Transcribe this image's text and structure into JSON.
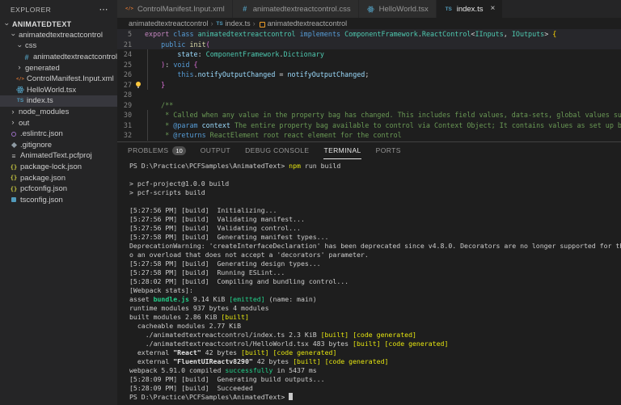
{
  "ui": {
    "close_glyph": "×",
    "chevron_glyph": "›",
    "more_glyph": "⋯",
    "breadcrumb_sep": "›",
    "decoration_glyph": "○"
  },
  "icons": {
    "xml": "</>",
    "css": "#",
    "ts": "TS",
    "json": "{}",
    "proj": "≡",
    "react": "",
    "eslint": "",
    "git": "",
    "tsconfig": "",
    "class": ""
  },
  "colors": {
    "editor_bg": "#1e1e1e",
    "sidebar_bg": "#252526",
    "tab_inactive_bg": "#2d2d2d",
    "selection_bg": "#37373d",
    "accent_ts_blue": "#519aba",
    "xml_orange": "#e37933",
    "json_yellow": "#cbcb41",
    "terminal_green": "#23d18b",
    "terminal_yellow": "#e5e510"
  },
  "explorer": {
    "title": "EXPLORER",
    "items": [
      {
        "label": "ANIMATEDTEXT",
        "depth": 0,
        "chevron": "down",
        "bold": true
      },
      {
        "label": "animatedtextreactcontrol",
        "depth": 1,
        "chevron": "down"
      },
      {
        "label": "css",
        "depth": 2,
        "chevron": "down"
      },
      {
        "label": "animatedtextreactcontrol.css",
        "depth": 3,
        "icon": "css"
      },
      {
        "label": "generated",
        "depth": 2,
        "chevron": "right"
      },
      {
        "label": "ControlManifest.Input.xml",
        "depth": 2,
        "icon": "xml"
      },
      {
        "label": "HelloWorld.tsx",
        "depth": 2,
        "icon": "react"
      },
      {
        "label": "index.ts",
        "depth": 2,
        "icon": "ts",
        "selected": true
      },
      {
        "label": "node_modules",
        "depth": 1,
        "chevron": "right"
      },
      {
        "label": "out",
        "depth": 1,
        "chevron": "right"
      },
      {
        "label": ".eslintrc.json",
        "depth": 1,
        "icon": "eslint"
      },
      {
        "label": ".gitignore",
        "depth": 1,
        "icon": "git"
      },
      {
        "label": "AnimatedText.pcfproj",
        "depth": 1,
        "icon": "proj"
      },
      {
        "label": "package-lock.json",
        "depth": 1,
        "icon": "json"
      },
      {
        "label": "package.json",
        "depth": 1,
        "icon": "json"
      },
      {
        "label": "pcfconfig.json",
        "depth": 1,
        "icon": "json"
      },
      {
        "label": "tsconfig.json",
        "depth": 1,
        "icon": "tsconfig"
      }
    ]
  },
  "editor_tabs": [
    {
      "label": "ControlManifest.Input.xml",
      "icon": "xml",
      "active": false
    },
    {
      "label": "animatedtextreactcontrol.css",
      "icon": "css",
      "active": false
    },
    {
      "label": "HelloWorld.tsx",
      "icon": "react",
      "active": false
    },
    {
      "label": "index.ts",
      "icon": "ts",
      "active": true
    }
  ],
  "breadcrumb": {
    "items": [
      {
        "label": "animatedtextreactcontrol"
      },
      {
        "label": "index.ts",
        "icon": "ts"
      },
      {
        "label": "animatedtextreactcontrol",
        "icon": "class"
      }
    ]
  },
  "editor": {
    "lines": [
      {
        "num": "5",
        "highlight": true,
        "tokens": [
          [
            "export ",
            "ctl"
          ],
          [
            "class ",
            "kw"
          ],
          [
            "animatedtextreactcontrol",
            "type"
          ],
          [
            " implements ",
            "kw"
          ],
          [
            "ComponentFramework",
            "type"
          ],
          [
            ".",
            "p"
          ],
          [
            "ReactControl",
            "type"
          ],
          [
            "<",
            "p"
          ],
          [
            "IInputs",
            "type"
          ],
          [
            ", ",
            "p"
          ],
          [
            "IOutputs",
            "type"
          ],
          [
            "> ",
            "p"
          ],
          [
            "{",
            "b1"
          ]
        ]
      },
      {
        "num": "21",
        "highlight": true,
        "tokens": [
          [
            "    ",
            "p"
          ],
          [
            "public ",
            "kw"
          ],
          [
            "init",
            "fn"
          ],
          [
            "(",
            "b2"
          ]
        ]
      },
      {
        "num": "24",
        "guide": true,
        "tokens": [
          [
            "        ",
            "p"
          ],
          [
            "state",
            "var"
          ],
          [
            ": ",
            "p"
          ],
          [
            "ComponentFramework",
            "type"
          ],
          [
            ".",
            "p"
          ],
          [
            "Dictionary",
            "type"
          ]
        ]
      },
      {
        "num": "25",
        "guide": true,
        "tokens": [
          [
            "    ",
            "p"
          ],
          [
            ")",
            "b2"
          ],
          [
            ": ",
            "p"
          ],
          [
            "void",
            "kw"
          ],
          [
            " ",
            "p"
          ],
          [
            "{",
            "b2"
          ]
        ]
      },
      {
        "num": "26",
        "guide": true,
        "tokens": [
          [
            "        ",
            "p"
          ],
          [
            "this",
            "kw"
          ],
          [
            ".",
            "p"
          ],
          [
            "notifyOutputChanged",
            "var"
          ],
          [
            " = ",
            "p"
          ],
          [
            "notifyOutputChanged",
            "var"
          ],
          [
            ";",
            "p"
          ]
        ]
      },
      {
        "num": "27",
        "guide": true,
        "lightbulb": true,
        "tokens": [
          [
            "    ",
            "p"
          ],
          [
            "}",
            "b2"
          ]
        ]
      },
      {
        "num": "28",
        "tokens": []
      },
      {
        "num": "29",
        "tokens": [
          [
            "    /**",
            "cmt"
          ]
        ]
      },
      {
        "num": "30",
        "guide": true,
        "tokens": [
          [
            "     * Called when any value in the property bag has changed. This includes field values, data-sets, global values su",
            "cmt"
          ]
        ]
      },
      {
        "num": "31",
        "guide": true,
        "tokens": [
          [
            "     * ",
            "cmt"
          ],
          [
            "@param",
            "kw"
          ],
          [
            " ",
            "cmt"
          ],
          [
            "context",
            "var"
          ],
          [
            " The entire property bag available to control via Context Object; It contains values as set up b",
            "cmt"
          ]
        ]
      },
      {
        "num": "32",
        "guide": true,
        "tokens": [
          [
            "     * ",
            "cmt"
          ],
          [
            "@returns",
            "kw"
          ],
          [
            " ReactElement root react element for the control",
            "cmt"
          ]
        ]
      }
    ]
  },
  "panel": {
    "tabs": [
      {
        "label": "PROBLEMS",
        "badge": "10",
        "active": false
      },
      {
        "label": "OUTPUT",
        "active": false
      },
      {
        "label": "DEBUG CONSOLE",
        "active": false
      },
      {
        "label": "TERMINAL",
        "active": true
      },
      {
        "label": "PORTS",
        "active": false
      }
    ],
    "terminal": {
      "lines": [
        {
          "tokens": [
            [
              "PS D:\\Practice\\PCFSamples\\AnimatedText> ",
              "d"
            ],
            [
              "npm",
              "y"
            ],
            [
              " run build",
              "d"
            ]
          ]
        },
        {
          "tokens": []
        },
        {
          "tokens": [
            [
              "> pcf-project@1.0.0 build",
              "d"
            ]
          ]
        },
        {
          "tokens": [
            [
              "> pcf-scripts build",
              "d"
            ]
          ]
        },
        {
          "tokens": []
        },
        {
          "tokens": [
            [
              "[5:27:56 PM] [build]  Initializing...",
              "d"
            ]
          ]
        },
        {
          "tokens": [
            [
              "[5:27:56 PM] [build]  Validating manifest...",
              "d"
            ]
          ]
        },
        {
          "tokens": [
            [
              "[5:27:56 PM] [build]  Validating control...",
              "d"
            ]
          ]
        },
        {
          "tokens": [
            [
              "[5:27:58 PM] [build]  Generating manifest types...",
              "d"
            ]
          ]
        },
        {
          "tokens": [
            [
              "DeprecationWarning: 'createInterfaceDeclaration' has been deprecated since v4.8.0. Decorators are no longer supported for thi",
              "d"
            ]
          ]
        },
        {
          "tokens": [
            [
              "o an overload that does not accept a 'decorators' parameter.",
              "d"
            ]
          ]
        },
        {
          "tokens": [
            [
              "[5:27:58 PM] [build]  Generating design types...",
              "d"
            ]
          ]
        },
        {
          "tokens": [
            [
              "[5:27:58 PM] [build]  Running ESLint...",
              "d"
            ]
          ]
        },
        {
          "tokens": [
            [
              "[5:28:02 PM] [build]  Compiling and bundling control...",
              "d"
            ]
          ]
        },
        {
          "tokens": [
            [
              "[Webpack stats]:",
              "d"
            ]
          ]
        },
        {
          "tokens": [
            [
              "asset ",
              "d"
            ],
            [
              "bundle.js",
              "gb"
            ],
            [
              " 9.14 KiB ",
              "d"
            ],
            [
              "[emitted]",
              "g"
            ],
            [
              " (name: main)",
              "d"
            ]
          ]
        },
        {
          "tokens": [
            [
              "runtime modules 937 bytes 4 modules",
              "d"
            ]
          ]
        },
        {
          "tokens": [
            [
              "built modules 2.86 KiB ",
              "d"
            ],
            [
              "[built]",
              "y"
            ]
          ]
        },
        {
          "tokens": [
            [
              "  cacheable modules 2.77 KiB",
              "d"
            ]
          ]
        },
        {
          "tokens": [
            [
              "    ./animatedtextreactcontrol/index.ts 2.3 KiB ",
              "d"
            ],
            [
              "[built]",
              "y"
            ],
            [
              " ",
              "d"
            ],
            [
              "[code generated]",
              "y"
            ]
          ]
        },
        {
          "tokens": [
            [
              "    ./animatedtextreactcontrol/HelloWorld.tsx 483 bytes ",
              "d"
            ],
            [
              "[built]",
              "y"
            ],
            [
              " ",
              "d"
            ],
            [
              "[code generated]",
              "y"
            ]
          ]
        },
        {
          "tokens": [
            [
              "  external ",
              "d"
            ],
            [
              "\"React\"",
              "wb"
            ],
            [
              " 42 bytes ",
              "d"
            ],
            [
              "[built]",
              "y"
            ],
            [
              " ",
              "d"
            ],
            [
              "[code generated]",
              "y"
            ]
          ]
        },
        {
          "tokens": [
            [
              "  external ",
              "d"
            ],
            [
              "\"FluentUIReactv8290\"",
              "wb"
            ],
            [
              " 42 bytes ",
              "d"
            ],
            [
              "[built]",
              "y"
            ],
            [
              " ",
              "d"
            ],
            [
              "[code generated]",
              "y"
            ]
          ]
        },
        {
          "tokens": [
            [
              "webpack 5.91.0 compiled ",
              "d"
            ],
            [
              "successfully",
              "g"
            ],
            [
              " in 5437 ms",
              "d"
            ]
          ]
        },
        {
          "tokens": [
            [
              "[5:28:09 PM] [build]  Generating build outputs...",
              "d"
            ]
          ]
        },
        {
          "tokens": [
            [
              "[5:28:09 PM] [build]  Succeeded",
              "d"
            ]
          ]
        },
        {
          "decoration": true,
          "tokens": [
            [
              "PS D:\\Practice\\PCFSamples\\AnimatedText> ",
              "d"
            ],
            [
              "",
              "cur"
            ]
          ]
        }
      ]
    }
  }
}
